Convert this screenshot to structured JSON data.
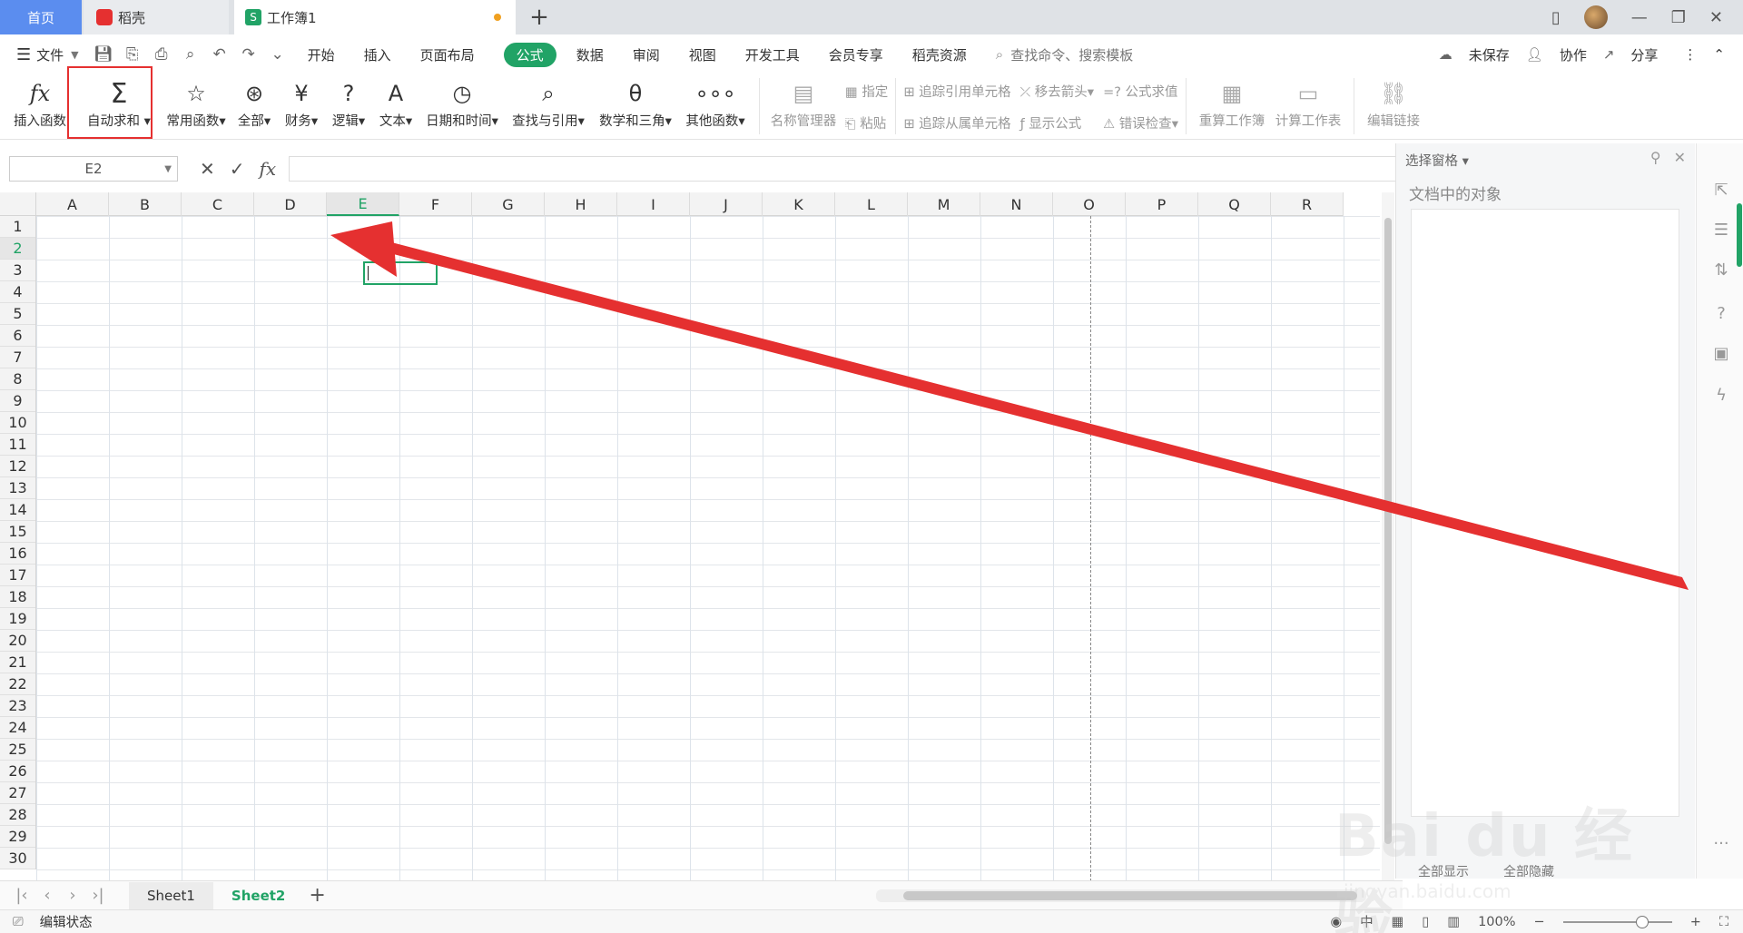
{
  "tabs": {
    "home": "首页",
    "daoke": "稻壳",
    "workbook": "工作簿1",
    "add": "+"
  },
  "menu": {
    "file": "文件",
    "items": [
      "开始",
      "插入",
      "页面布局",
      "公式",
      "数据",
      "审阅",
      "视图",
      "开发工具",
      "会员专享",
      "稻壳资源"
    ],
    "active": "公式",
    "search": "查找命令、搜索模板",
    "unsaved": "未保存",
    "collab": "协作",
    "share": "分享"
  },
  "ribbon": {
    "insert_func": "插入函数",
    "autosum": "自动求和",
    "common": "常用函数",
    "all": "全部",
    "finance": "财务",
    "logic": "逻辑",
    "text": "文本",
    "datetime": "日期和时间",
    "lookup": "查找与引用",
    "math": "数学和三角",
    "other": "其他函数",
    "name_mgr": "名称管理器",
    "define": "指定",
    "paste": "粘贴",
    "trace_prec": "追踪引用单元格",
    "trace_dep": "追踪从属单元格",
    "remove_arrows": "移去箭头",
    "show_formula": "显示公式",
    "eval_formula": "公式求值",
    "error_check": "错误检查",
    "recalc_book": "重算工作簿",
    "calc_sheet": "计算工作表",
    "edit_links": "编辑链接"
  },
  "formula_bar": {
    "namebox": "E2",
    "value": ""
  },
  "grid": {
    "columns": [
      "A",
      "B",
      "C",
      "D",
      "E",
      "F",
      "G",
      "H",
      "I",
      "J",
      "K",
      "L",
      "M",
      "N",
      "O",
      "P",
      "Q",
      "R"
    ],
    "rows": [
      "1",
      "2",
      "3",
      "4",
      "5",
      "6",
      "7",
      "8",
      "9",
      "10",
      "11",
      "12",
      "13",
      "14",
      "15",
      "16",
      "17",
      "18",
      "19",
      "20",
      "21",
      "22",
      "23",
      "24",
      "25",
      "26",
      "27",
      "28",
      "29",
      "30"
    ],
    "selected_col": "E",
    "selected_row": "2"
  },
  "pane": {
    "title": "选择窗格",
    "subtitle": "文档中的对象",
    "show_all": "全部显示",
    "hide_all": "全部隐藏"
  },
  "sheets": [
    "Sheet1",
    "Sheet2"
  ],
  "active_sheet": "Sheet2",
  "status": {
    "mode": "编辑状态",
    "zoom": "100%",
    "ime": "中"
  },
  "watermark": {
    "brand": "Bai du 经验",
    "url": "jingyan.baidu.com"
  },
  "colors": {
    "accent": "#21a366",
    "annotation": "#e53030",
    "tab_home": "#5b8def"
  }
}
